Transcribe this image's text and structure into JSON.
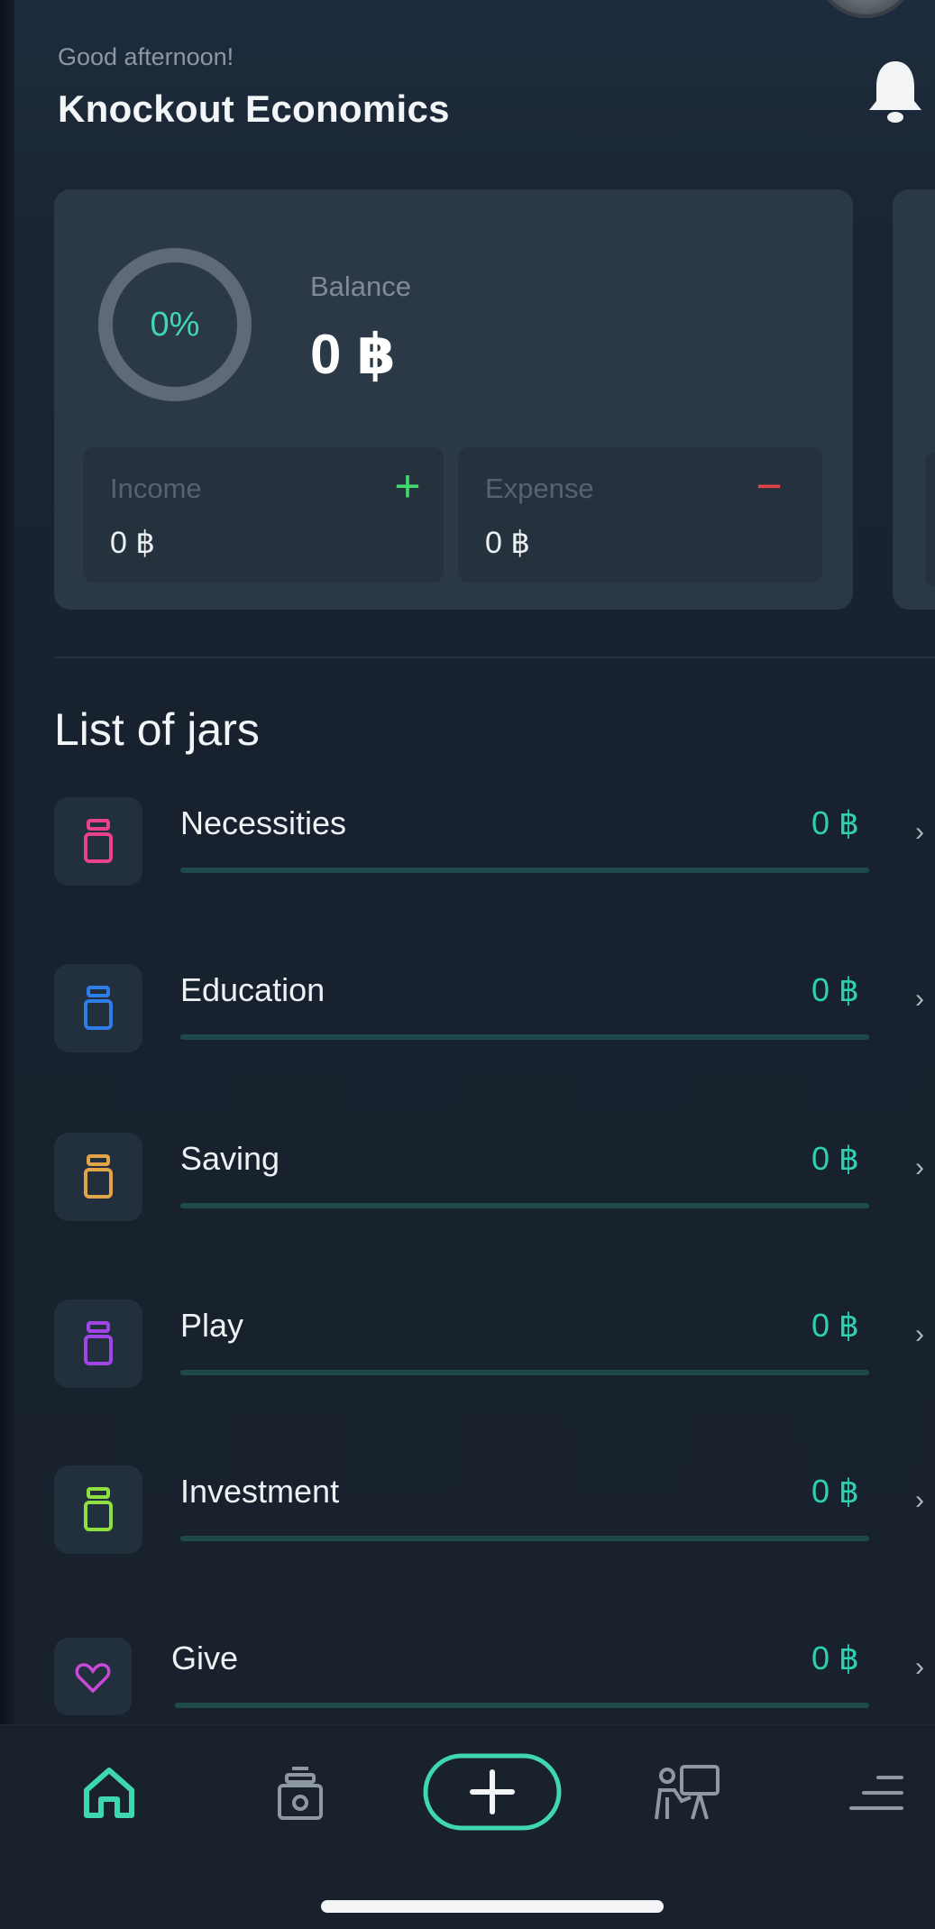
{
  "header": {
    "greeting": "Good afternoon!",
    "username": "Knockout Economics"
  },
  "balance_card": {
    "progress_label": "0%",
    "progress_fraction": 0,
    "balance_label": "Balance",
    "balance_value": "0 ฿",
    "income": {
      "label": "Income",
      "value": "0 ฿",
      "sign": "+"
    },
    "expense": {
      "label": "Expense",
      "value": "0 ฿",
      "sign": "−"
    }
  },
  "jars_section": {
    "title": "List of jars",
    "items": [
      {
        "name": "Necessities",
        "amount": "0 ฿",
        "progress": 0,
        "color": "#e8428a"
      },
      {
        "name": "Education",
        "amount": "0 ฿",
        "progress": 0,
        "color": "#2f7de8"
      },
      {
        "name": "Saving",
        "amount": "0 ฿",
        "progress": 0,
        "color": "#e3a448"
      },
      {
        "name": "Play",
        "amount": "0 ฿",
        "progress": 0,
        "color": "#a046e6"
      },
      {
        "name": "Investment",
        "amount": "0 ฿",
        "progress": 0,
        "color": "#8ee040"
      },
      {
        "name": "Give",
        "amount": "0 ฿",
        "progress": 0,
        "color": "#c84ad6"
      }
    ]
  },
  "nav": {
    "items": [
      "home-icon",
      "jar-icon",
      "add-icon",
      "teacher-board-icon",
      "menu-icon"
    ],
    "active_color": "#3fd6b4",
    "inactive_color": "#8d98a4"
  },
  "colors": {
    "accent": "#2fd0b2",
    "income": "#3fd96c",
    "expense": "#e0424a"
  }
}
